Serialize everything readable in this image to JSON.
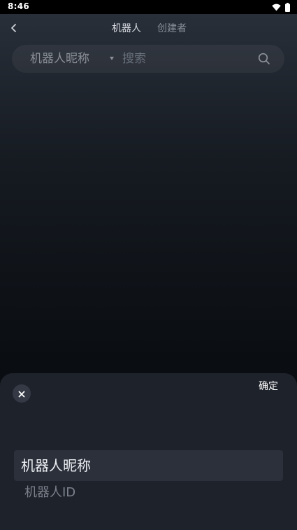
{
  "status_bar": {
    "time": "8:46",
    "icons": [
      "wifi-icon",
      "battery-icon"
    ]
  },
  "header": {
    "back_icon": "chevron-left-icon",
    "tabs": [
      {
        "label": "机器人",
        "active": true
      },
      {
        "label": "创建者",
        "active": false
      }
    ]
  },
  "search": {
    "type_label": "机器人昵称",
    "placeholder": "搜索",
    "value": "",
    "icon": "search-icon"
  },
  "sheet": {
    "close_icon": "close-icon",
    "confirm_label": "确定",
    "options": [
      {
        "label": "机器人昵称",
        "selected": true
      },
      {
        "label": "机器人ID",
        "selected": false
      }
    ]
  },
  "colors": {
    "background": "#0a0d11",
    "sheet": "#1e222b",
    "selected_row": "#2b303b",
    "active_tab": "#d9dde3",
    "inactive_tab": "#8a909a"
  }
}
